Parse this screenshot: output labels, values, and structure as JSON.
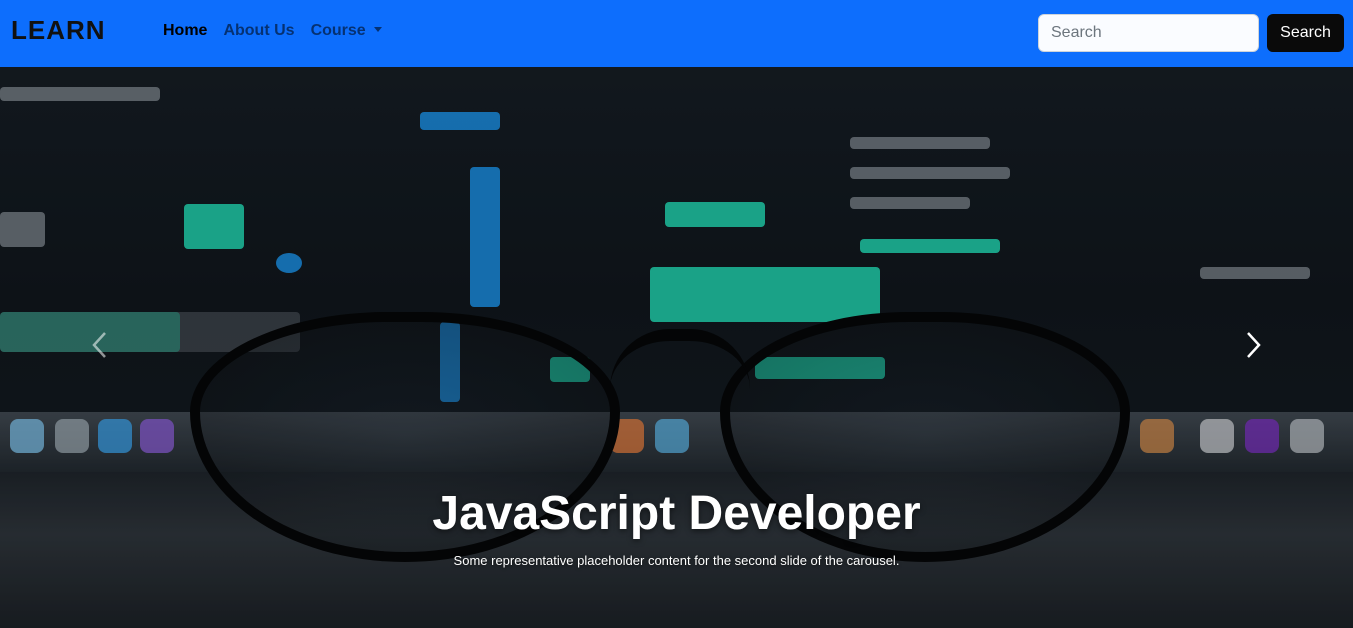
{
  "navbar": {
    "brand": "LEARN",
    "links": [
      {
        "label": "Home",
        "active": true
      },
      {
        "label": "About Us",
        "active": false
      },
      {
        "label": "Course",
        "active": false,
        "dropdown": true
      }
    ],
    "search": {
      "placeholder": "Search",
      "value": "",
      "button_label": "Search"
    }
  },
  "carousel": {
    "slide_title": "JavaScript Developer",
    "slide_text": "Some representative placeholder content for the second slide of the carousel.",
    "prev_icon": "chevron-left-icon",
    "next_icon": "chevron-right-icon"
  },
  "colors": {
    "navbar_bg": "#0d6efd",
    "search_button_bg": "#0a0a0a",
    "caption_text": "#ffffff"
  }
}
